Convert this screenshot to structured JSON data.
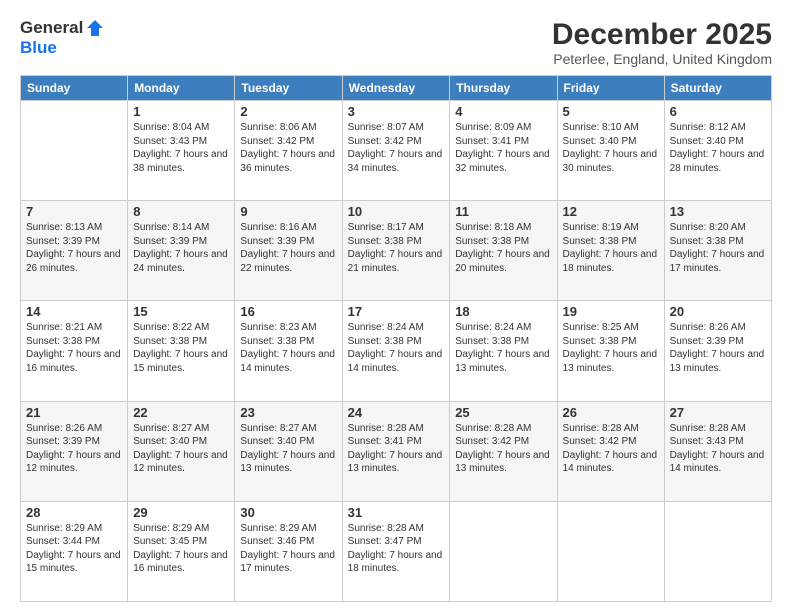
{
  "logo": {
    "general": "General",
    "blue": "Blue"
  },
  "title": "December 2025",
  "subtitle": "Peterlee, England, United Kingdom",
  "headers": [
    "Sunday",
    "Monday",
    "Tuesday",
    "Wednesday",
    "Thursday",
    "Friday",
    "Saturday"
  ],
  "weeks": [
    [
      {
        "day": "",
        "sunrise": "",
        "sunset": "",
        "daylight": ""
      },
      {
        "day": "1",
        "sunrise": "Sunrise: 8:04 AM",
        "sunset": "Sunset: 3:43 PM",
        "daylight": "Daylight: 7 hours and 38 minutes."
      },
      {
        "day": "2",
        "sunrise": "Sunrise: 8:06 AM",
        "sunset": "Sunset: 3:42 PM",
        "daylight": "Daylight: 7 hours and 36 minutes."
      },
      {
        "day": "3",
        "sunrise": "Sunrise: 8:07 AM",
        "sunset": "Sunset: 3:42 PM",
        "daylight": "Daylight: 7 hours and 34 minutes."
      },
      {
        "day": "4",
        "sunrise": "Sunrise: 8:09 AM",
        "sunset": "Sunset: 3:41 PM",
        "daylight": "Daylight: 7 hours and 32 minutes."
      },
      {
        "day": "5",
        "sunrise": "Sunrise: 8:10 AM",
        "sunset": "Sunset: 3:40 PM",
        "daylight": "Daylight: 7 hours and 30 minutes."
      },
      {
        "day": "6",
        "sunrise": "Sunrise: 8:12 AM",
        "sunset": "Sunset: 3:40 PM",
        "daylight": "Daylight: 7 hours and 28 minutes."
      }
    ],
    [
      {
        "day": "7",
        "sunrise": "Sunrise: 8:13 AM",
        "sunset": "Sunset: 3:39 PM",
        "daylight": "Daylight: 7 hours and 26 minutes."
      },
      {
        "day": "8",
        "sunrise": "Sunrise: 8:14 AM",
        "sunset": "Sunset: 3:39 PM",
        "daylight": "Daylight: 7 hours and 24 minutes."
      },
      {
        "day": "9",
        "sunrise": "Sunrise: 8:16 AM",
        "sunset": "Sunset: 3:39 PM",
        "daylight": "Daylight: 7 hours and 22 minutes."
      },
      {
        "day": "10",
        "sunrise": "Sunrise: 8:17 AM",
        "sunset": "Sunset: 3:38 PM",
        "daylight": "Daylight: 7 hours and 21 minutes."
      },
      {
        "day": "11",
        "sunrise": "Sunrise: 8:18 AM",
        "sunset": "Sunset: 3:38 PM",
        "daylight": "Daylight: 7 hours and 20 minutes."
      },
      {
        "day": "12",
        "sunrise": "Sunrise: 8:19 AM",
        "sunset": "Sunset: 3:38 PM",
        "daylight": "Daylight: 7 hours and 18 minutes."
      },
      {
        "day": "13",
        "sunrise": "Sunrise: 8:20 AM",
        "sunset": "Sunset: 3:38 PM",
        "daylight": "Daylight: 7 hours and 17 minutes."
      }
    ],
    [
      {
        "day": "14",
        "sunrise": "Sunrise: 8:21 AM",
        "sunset": "Sunset: 3:38 PM",
        "daylight": "Daylight: 7 hours and 16 minutes."
      },
      {
        "day": "15",
        "sunrise": "Sunrise: 8:22 AM",
        "sunset": "Sunset: 3:38 PM",
        "daylight": "Daylight: 7 hours and 15 minutes."
      },
      {
        "day": "16",
        "sunrise": "Sunrise: 8:23 AM",
        "sunset": "Sunset: 3:38 PM",
        "daylight": "Daylight: 7 hours and 14 minutes."
      },
      {
        "day": "17",
        "sunrise": "Sunrise: 8:24 AM",
        "sunset": "Sunset: 3:38 PM",
        "daylight": "Daylight: 7 hours and 14 minutes."
      },
      {
        "day": "18",
        "sunrise": "Sunrise: 8:24 AM",
        "sunset": "Sunset: 3:38 PM",
        "daylight": "Daylight: 7 hours and 13 minutes."
      },
      {
        "day": "19",
        "sunrise": "Sunrise: 8:25 AM",
        "sunset": "Sunset: 3:38 PM",
        "daylight": "Daylight: 7 hours and 13 minutes."
      },
      {
        "day": "20",
        "sunrise": "Sunrise: 8:26 AM",
        "sunset": "Sunset: 3:39 PM",
        "daylight": "Daylight: 7 hours and 13 minutes."
      }
    ],
    [
      {
        "day": "21",
        "sunrise": "Sunrise: 8:26 AM",
        "sunset": "Sunset: 3:39 PM",
        "daylight": "Daylight: 7 hours and 12 minutes."
      },
      {
        "day": "22",
        "sunrise": "Sunrise: 8:27 AM",
        "sunset": "Sunset: 3:40 PM",
        "daylight": "Daylight: 7 hours and 12 minutes."
      },
      {
        "day": "23",
        "sunrise": "Sunrise: 8:27 AM",
        "sunset": "Sunset: 3:40 PM",
        "daylight": "Daylight: 7 hours and 13 minutes."
      },
      {
        "day": "24",
        "sunrise": "Sunrise: 8:28 AM",
        "sunset": "Sunset: 3:41 PM",
        "daylight": "Daylight: 7 hours and 13 minutes."
      },
      {
        "day": "25",
        "sunrise": "Sunrise: 8:28 AM",
        "sunset": "Sunset: 3:42 PM",
        "daylight": "Daylight: 7 hours and 13 minutes."
      },
      {
        "day": "26",
        "sunrise": "Sunrise: 8:28 AM",
        "sunset": "Sunset: 3:42 PM",
        "daylight": "Daylight: 7 hours and 14 minutes."
      },
      {
        "day": "27",
        "sunrise": "Sunrise: 8:28 AM",
        "sunset": "Sunset: 3:43 PM",
        "daylight": "Daylight: 7 hours and 14 minutes."
      }
    ],
    [
      {
        "day": "28",
        "sunrise": "Sunrise: 8:29 AM",
        "sunset": "Sunset: 3:44 PM",
        "daylight": "Daylight: 7 hours and 15 minutes."
      },
      {
        "day": "29",
        "sunrise": "Sunrise: 8:29 AM",
        "sunset": "Sunset: 3:45 PM",
        "daylight": "Daylight: 7 hours and 16 minutes."
      },
      {
        "day": "30",
        "sunrise": "Sunrise: 8:29 AM",
        "sunset": "Sunset: 3:46 PM",
        "daylight": "Daylight: 7 hours and 17 minutes."
      },
      {
        "day": "31",
        "sunrise": "Sunrise: 8:28 AM",
        "sunset": "Sunset: 3:47 PM",
        "daylight": "Daylight: 7 hours and 18 minutes."
      },
      {
        "day": "",
        "sunrise": "",
        "sunset": "",
        "daylight": ""
      },
      {
        "day": "",
        "sunrise": "",
        "sunset": "",
        "daylight": ""
      },
      {
        "day": "",
        "sunrise": "",
        "sunset": "",
        "daylight": ""
      }
    ]
  ]
}
